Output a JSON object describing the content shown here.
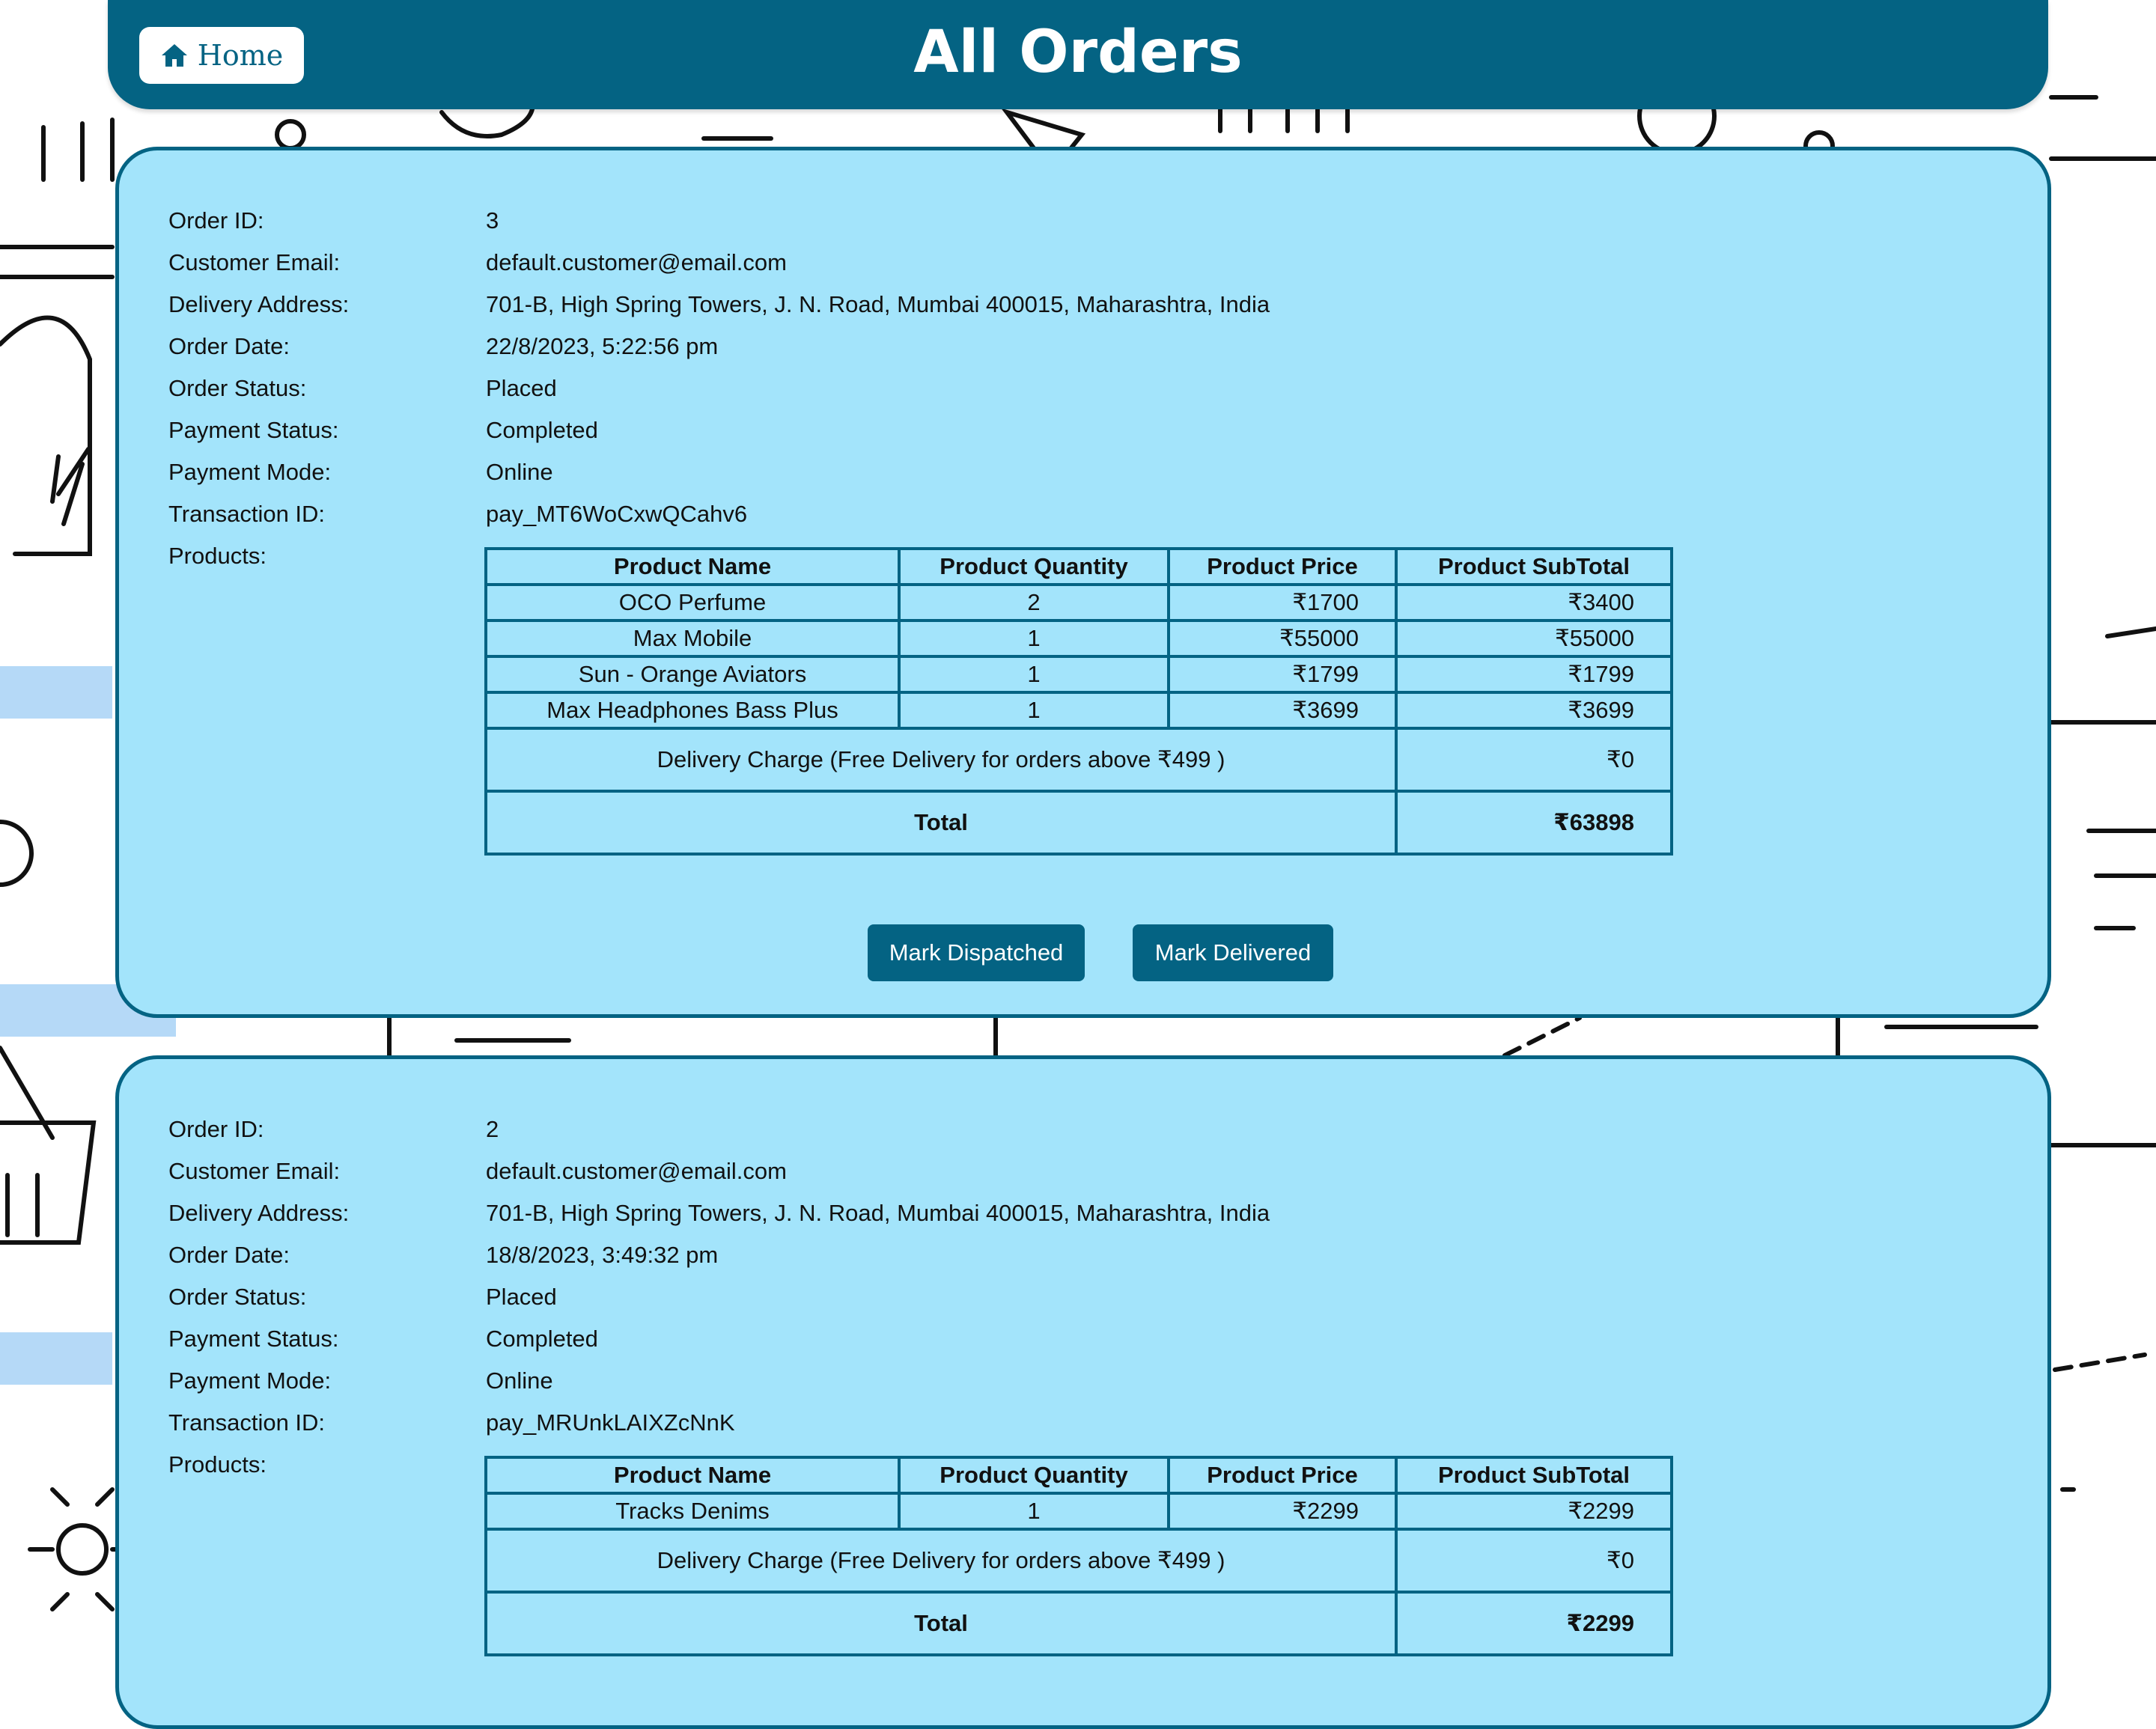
{
  "header": {
    "home_label": "Home",
    "title": "All Orders"
  },
  "labels": {
    "order_id": "Order ID:",
    "customer_email": "Customer Email:",
    "delivery_address": "Delivery Address:",
    "order_date": "Order Date:",
    "order_status": "Order Status:",
    "payment_status": "Payment Status:",
    "payment_mode": "Payment Mode:",
    "transaction_id": "Transaction ID:",
    "products": "Products:"
  },
  "table_headers": [
    "Product Name",
    "Product Quantity",
    "Product Price",
    "Product SubTotal"
  ],
  "delivery_charge_label": "Delivery Charge (Free Delivery for orders above ₹499 )",
  "total_label": "Total",
  "actions": {
    "dispatch": "Mark Dispatched",
    "deliver": "Mark Delivered"
  },
  "orders": [
    {
      "order_id": "3",
      "customer_email": "default.customer@email.com",
      "delivery_address": "701-B, High Spring Towers, J. N. Road, Mumbai 400015, Maharashtra, India",
      "order_date": "22/8/2023, 5:22:56 pm",
      "order_status": "Placed",
      "payment_status": "Completed",
      "payment_mode": "Online",
      "transaction_id": "pay_MT6WoCxwQCahv6",
      "products": [
        {
          "name": "OCO Perfume",
          "qty": "2",
          "price": "₹1700",
          "subtotal": "₹3400"
        },
        {
          "name": "Max Mobile",
          "qty": "1",
          "price": "₹55000",
          "subtotal": "₹55000"
        },
        {
          "name": "Sun - Orange Aviators",
          "qty": "1",
          "price": "₹1799",
          "subtotal": "₹1799"
        },
        {
          "name": "Max Headphones Bass Plus",
          "qty": "1",
          "price": "₹3699",
          "subtotal": "₹3699"
        }
      ],
      "delivery_charge": "₹0",
      "total": "₹63898"
    },
    {
      "order_id": "2",
      "customer_email": "default.customer@email.com",
      "delivery_address": "701-B, High Spring Towers, J. N. Road, Mumbai 400015, Maharashtra, India",
      "order_date": "18/8/2023, 3:49:32 pm",
      "order_status": "Placed",
      "payment_status": "Completed",
      "payment_mode": "Online",
      "transaction_id": "pay_MRUnkLAIXZcNnK",
      "products": [
        {
          "name": "Tracks Denims",
          "qty": "1",
          "price": "₹2299",
          "subtotal": "₹2299"
        }
      ],
      "delivery_charge": "₹0",
      "total": "₹2299"
    }
  ],
  "colors": {
    "primary": "#046383",
    "card_background": "#a3e4fb",
    "button_text": "#ffffff"
  },
  "icons": [
    "home-icon"
  ]
}
